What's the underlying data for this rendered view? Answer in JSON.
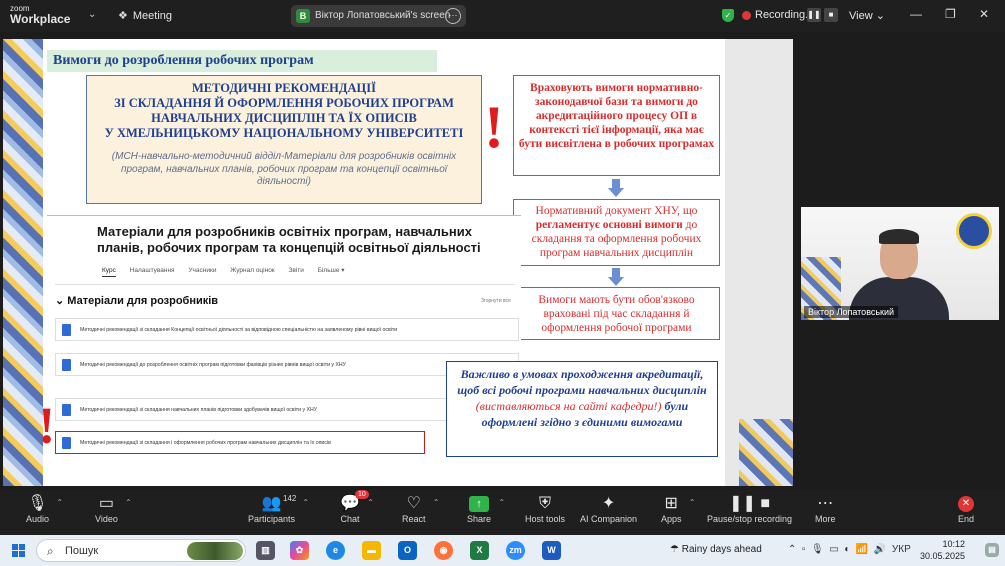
{
  "topbar": {
    "logo_small": "zoom",
    "logo_big": "Workplace",
    "meeting_label": "Meeting",
    "share_badge": "B",
    "share_label": "Віктор Лопатовський's screen",
    "recording_label": "Recording...",
    "view_label": "View"
  },
  "slide": {
    "title": "Вимоги до розроблення робочих програм",
    "method_box": {
      "heading_lines": [
        "МЕТОДИЧНІ РЕКОМЕНДАЦІЇ",
        "ЗІ СКЛАДАННЯ Й ОФОРМЛЕННЯ РОБОЧИХ ПРОГРАМ",
        "НАВЧАЛЬНИХ ДИСЦИПЛІН ТА ЇХ ОПИСІВ",
        "У ХМЕЛЬНИЦЬКОМУ НАЦІОНАЛЬНОМУ УНІВЕРСИТЕТІ"
      ],
      "subtitle": "(МСН-навчально-методичний відділ-Матеріали для розробників освітніх програм, навчальних планів, робочих програм та концепції освітньої діяльності)"
    },
    "exclamation": "!",
    "red_box_1": "Враховують вимоги нормативно-законодавчої бази та вимоги до акредитаційного процесу ОП в контексті тієї інформації, яка має бути висвітлена в робочих програмах",
    "red_box_2": {
      "before": "Нормативний документ ХНУ, що ",
      "bold": "регламентує основні вимоги",
      "after": " до складання та оформлення робочих програм навчальних дисциплін"
    },
    "red_box_3": "Вимоги мають бути обов'язково враховані під час складання й оформлення робочої програми",
    "blue_box": {
      "part1": "Важливо в умовах проходження акредитації, щоб всі робочі програми навчальних дисциплін ",
      "red": "(виставляються на сайті кафедри!)",
      "part2": " були оформлені згідно з єдиними вимогами"
    },
    "portal": {
      "title": "Матеріали для розробників освітніх програм, навчальних планів, робочих програм та концепцій освітньої діяльності",
      "nav": [
        "Курс",
        "Налаштування",
        "Учасники",
        "Журнал оцінок",
        "Звіти",
        "Більше ▾"
      ],
      "section": "Матеріали для розробників",
      "collapse": "Згорнути все",
      "items": [
        "Методичні рекомендації зі складання Концепції освітньої діяльності за відповідною спеціальністю на заявленому рівні вищої освіти",
        "Методичні рекомендації до розроблення освітніх програм підготовки фахівців різних рівнів вищої освіти у ХНУ",
        "Методичні рекомендації зі складання навчальних планів підготовки здобувачів вищої освіти у ХНУ",
        "Методичні рекомендації зі складання і оформлення робочих програм навчальних дисциплін та їх описів"
      ]
    }
  },
  "camera": {
    "name": "Віктор Лопатовський"
  },
  "toolbar": {
    "audio": "Audio",
    "video": "Video",
    "participants": "Participants",
    "participants_count": "142",
    "chat": "Chat",
    "chat_badge": "10",
    "react": "React",
    "share": "Share",
    "host_tools": "Host tools",
    "ai_companion": "AI Companion",
    "apps": "Apps",
    "pause_recording": "Pause/stop recording",
    "more": "More",
    "end": "End"
  },
  "taskbar": {
    "search_placeholder": "Пошук",
    "weather": "Rainy days ahead",
    "lang": "УКР",
    "time": "10:12",
    "date": "30.05.2025"
  }
}
